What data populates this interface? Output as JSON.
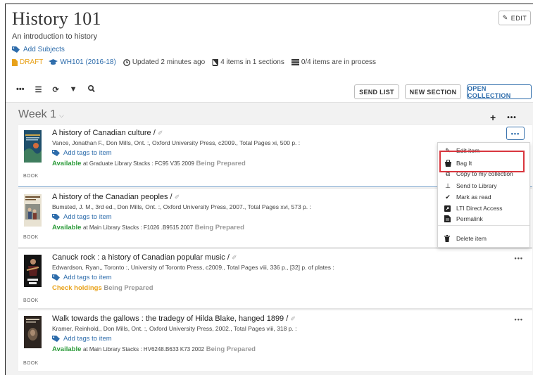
{
  "header": {
    "title": "History 101",
    "subtitle": "An introduction to history",
    "add_subjects": "Add Subjects",
    "edit_label": "EDIT",
    "draft": "DRAFT",
    "course": "WH101 (2016-18)",
    "updated": "Updated 2 minutes ago",
    "items_count": "4 items in 1 sections",
    "in_process": "0/4 items are in process"
  },
  "toolbar": {
    "send_list": "SEND LIST",
    "new_section": "NEW SECTION",
    "open_collection": "OPEN COLLECTION",
    "icons": [
      "more-icon",
      "list-icon",
      "refresh-icon",
      "filter-icon",
      "search-icon"
    ]
  },
  "section": {
    "title": "Week 1"
  },
  "items": [
    {
      "title": "A history of Canadian culture /",
      "author": "Vance, Jonathan F., Don Mills, Ont. :, Oxford University Press, c2009., Total Pages xi, 500 p. :",
      "tags": "Add tags to item",
      "status": "Available",
      "location": "at Graduate Library Stacks : FC95 V35 2009",
      "prep": "Being Prepared",
      "type": "BOOK"
    },
    {
      "title": "A history of the Canadian peoples /",
      "author": "Bumsted, J. M., 3rd ed., Don Mills, Ont. :, Oxford University Press, 2007., Total Pages xvi, 573 p. :",
      "tags": "Add tags to item",
      "status": "Available",
      "location": "at Main Library Stacks : F1026 .B9515 2007",
      "prep": "Being Prepared",
      "type": "BOOK"
    },
    {
      "title": "Canuck rock : a history of Canadian popular music /",
      "author": "Edwardson, Ryan,, Toronto :, University of Toronto Press, c2009., Total Pages viii, 336 p., [32] p. of plates :",
      "tags": "Add tags to item",
      "status": "Check holdings",
      "location": "",
      "prep": "Being Prepared",
      "type": "BOOK"
    },
    {
      "title": "Walk towards the gallows : the tradegy of Hilda Blake, hanged 1899 /",
      "author": "Kramer, Reinhold,, Don Mills, Ont. :, Oxford University Press, 2002., Total Pages viii, 318 p. :",
      "tags": "Add tags to item",
      "status": "Available",
      "location": "at Main Library Stacks : HV6248.B633 K73 2002",
      "prep": "Being Prepared",
      "type": "BOOK"
    }
  ],
  "menu": {
    "items": [
      {
        "label": "Edit item",
        "icon": "pencil-icon"
      },
      {
        "label": "Bag It",
        "icon": "bag-icon"
      },
      {
        "label": "Copy to my collection",
        "icon": "copy-icon"
      },
      {
        "label": "Send to Library",
        "icon": "pin-icon"
      },
      {
        "label": "Mark as read",
        "icon": "check-icon"
      },
      {
        "label": "LTI Direct Access",
        "icon": "external-link-icon"
      },
      {
        "label": "Permalink",
        "icon": "permalink-icon"
      },
      {
        "label": "Delete item",
        "icon": "trash-icon"
      }
    ]
  },
  "colors": {
    "link_blue": "#2d6cab",
    "available_green": "#2c9b3a",
    "draft_orange": "#e8a21b",
    "highlight_red": "#d9363e"
  }
}
